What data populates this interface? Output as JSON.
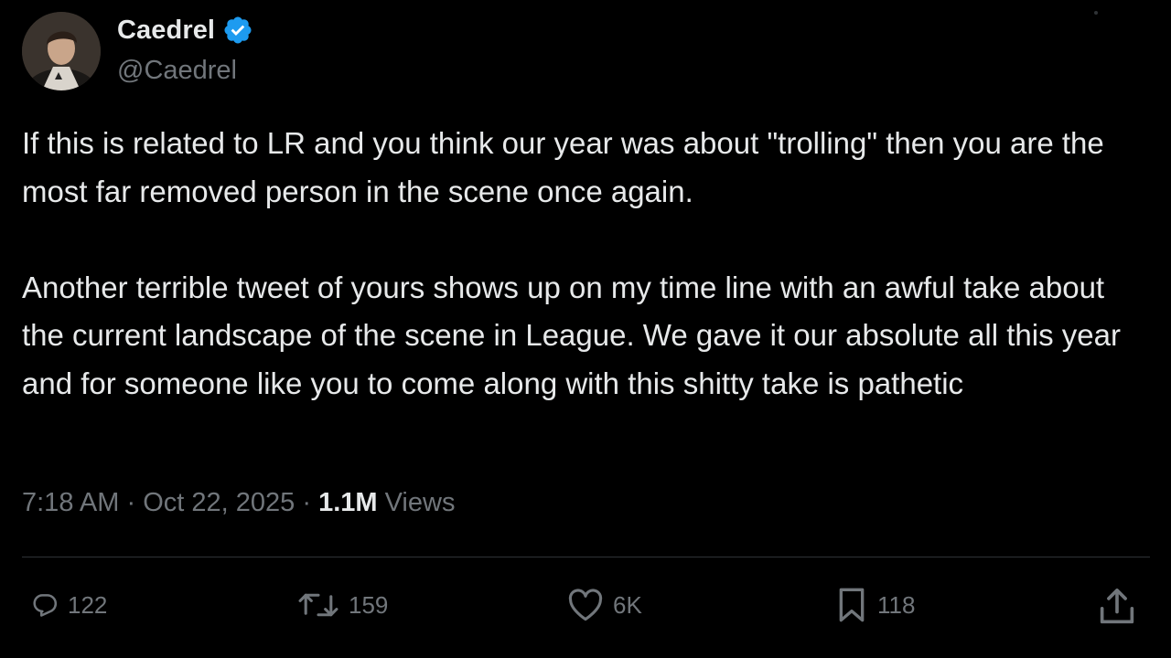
{
  "author": {
    "display_name": "Caedrel",
    "handle": "@Caedrel",
    "verified": true
  },
  "tweet": {
    "paragraphs": [
      "If this is related to LR and you think our year was about \"trolling\" then you are the most far removed person in the scene once again.",
      "Another terrible tweet of yours shows up on my time line with an awful take about the current landscape of the scene in League. We gave it our absolute all this year and for someone like you to come along with this shitty take is pathetic"
    ],
    "time": "7:18 AM",
    "separator": "·",
    "date": "Oct 22, 2025",
    "views_count": "1.1M",
    "views_label": "Views"
  },
  "actions": {
    "replies": "122",
    "reposts": "159",
    "likes": "6K",
    "bookmarks": "118"
  },
  "icons": {
    "reply": "reply-icon",
    "repost": "repost-icon",
    "like": "heart-icon",
    "bookmark": "bookmark-icon",
    "share": "share-icon",
    "verified": "verified-badge-icon"
  },
  "colors": {
    "background": "#000000",
    "text": "#e7e9ea",
    "secondary_text": "#71767b",
    "verified": "#1d9bf0",
    "divider": "#2f3336"
  }
}
